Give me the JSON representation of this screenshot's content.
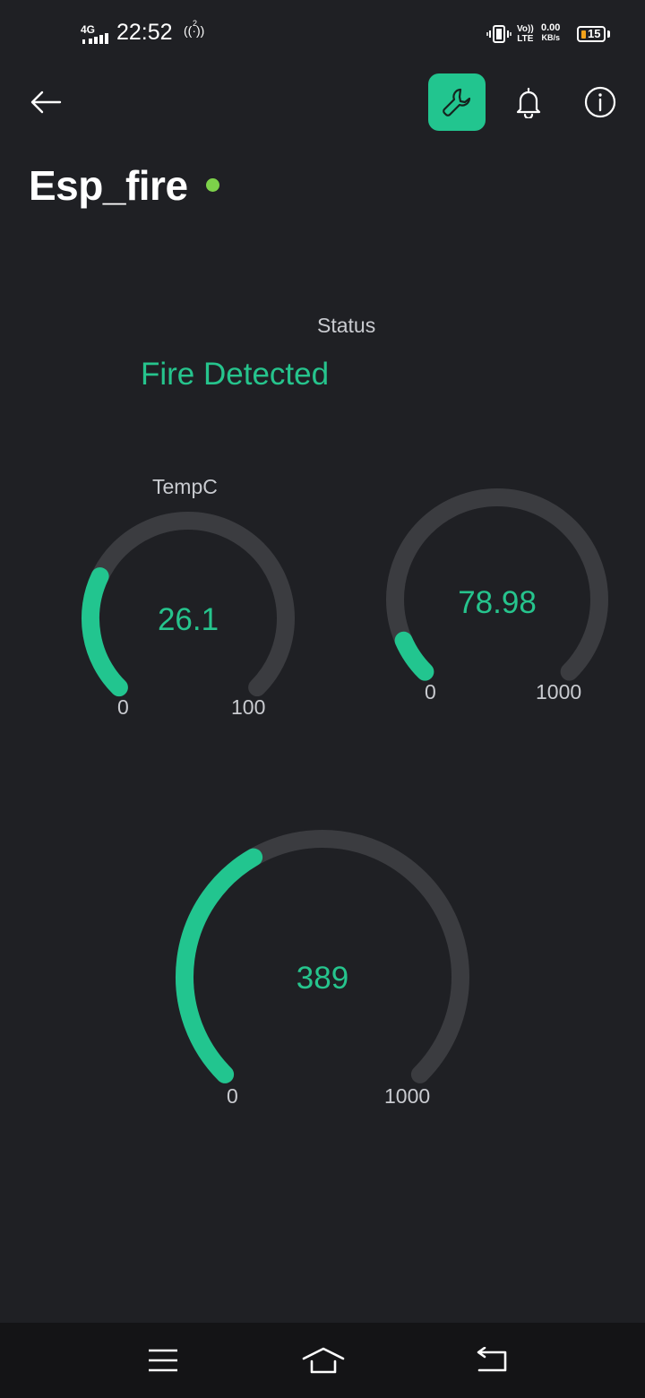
{
  "status_bar": {
    "time": "22:52",
    "network": "4G",
    "hotspot": "2",
    "lte_top": "Vo))",
    "lte_bottom": "LTE",
    "speed_top": "0.00",
    "speed_bottom": "KB/s",
    "battery": "15"
  },
  "header": {
    "device_name": "Esp_fire",
    "online_color": "#7dd14a",
    "accent": "#22c58f"
  },
  "status": {
    "label": "Status",
    "value": "Fire Detected"
  },
  "gauges": [
    {
      "label": "TempC",
      "value": "26.1",
      "min": "0",
      "max": "100",
      "fraction": 0.261
    },
    {
      "label": "",
      "value": "78.98",
      "min": "0",
      "max": "1000",
      "fraction": 0.079
    },
    {
      "label": "",
      "value": "389",
      "min": "0",
      "max": "1000",
      "fraction": 0.389
    }
  ],
  "icons": {
    "back": "arrow-left-icon",
    "settings": "wrench-icon",
    "notifications": "bell-icon",
    "info": "info-icon",
    "nav_menu": "menu-icon",
    "nav_home": "home-icon",
    "nav_back": "return-icon"
  }
}
